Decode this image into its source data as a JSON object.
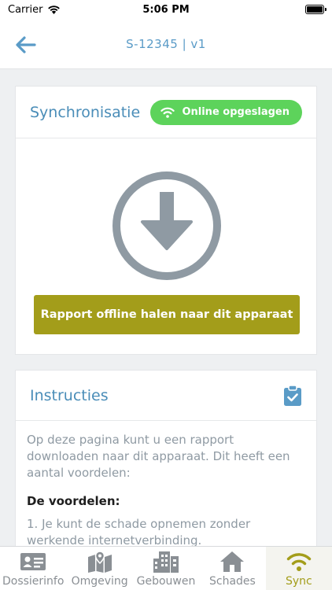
{
  "status": {
    "carrier": "Carrier",
    "time": "5:06 PM"
  },
  "header": {
    "title": "S-12345 | v1"
  },
  "sync_card": {
    "title": "Synchronisatie",
    "badge": "Online opgeslagen",
    "button_label": "Rapport offline halen naar dit apparaat"
  },
  "instructions": {
    "title": "Instructies",
    "intro": "Op deze pagina kunt u een rapport downloaden naar dit apparaat. Dit heeft een aantal voordelen:",
    "subheading": "De voordelen:",
    "item1": "1. Je kunt de schade opnemen zonder werkende internetverbinding."
  },
  "tabs": [
    {
      "label": "Dossierinfo",
      "icon": "id-card-icon"
    },
    {
      "label": "Omgeving",
      "icon": "map-icon"
    },
    {
      "label": "Gebouwen",
      "icon": "buildings-icon"
    },
    {
      "label": "Schades",
      "icon": "house-icon"
    },
    {
      "label": "Sync",
      "icon": "wifi-icon"
    }
  ],
  "colors": {
    "accent": "#a39d1a",
    "title_blue": "#4a8db8",
    "online_green": "#5dd35b",
    "icon_grey": "#8f9aa3"
  }
}
